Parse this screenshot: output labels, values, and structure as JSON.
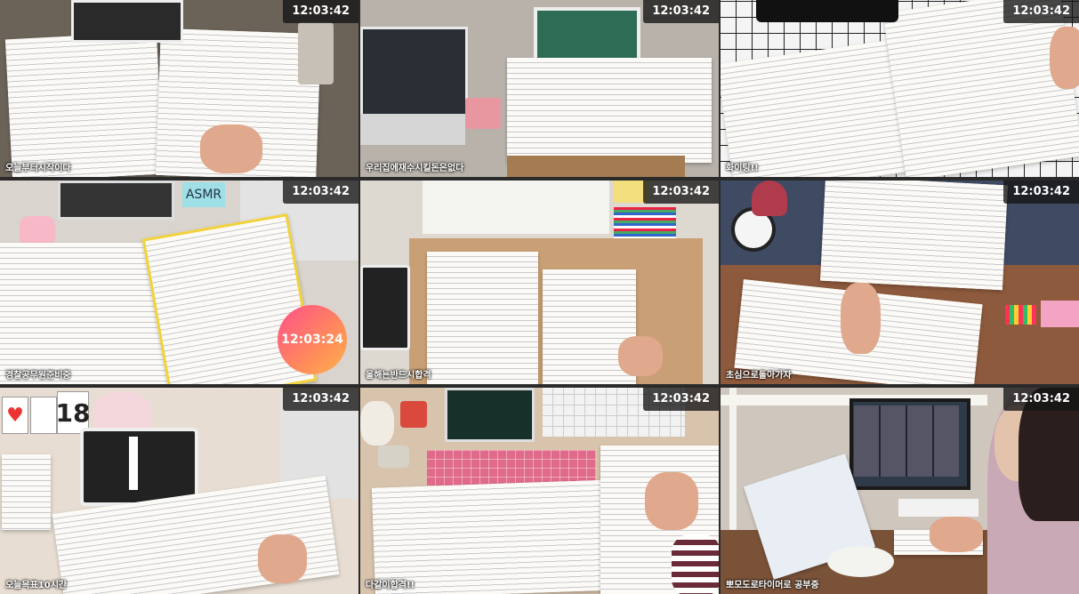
{
  "tiles": [
    {
      "timer": "12:03:42",
      "name": "오늘부터시작이다"
    },
    {
      "timer": "12:03:42",
      "name": "우리집에재수시킬돈은없다"
    },
    {
      "timer": "12:03:42",
      "name": "화이팅!!"
    },
    {
      "timer": "12:03:42",
      "name": "경찰공무원준비중",
      "badge": "12:03:24",
      "sticker": "ASMR"
    },
    {
      "timer": "12:03:42",
      "name": "올해는반드시합격"
    },
    {
      "timer": "12:03:42",
      "name": "초심으로돌아가자"
    },
    {
      "timer": "12:03:42",
      "name": "오늘목표10시간",
      "calendar": "18"
    },
    {
      "timer": "12:03:42",
      "name": "다같이합격!!"
    },
    {
      "timer": "12:03:42",
      "name": "뽀모도로타이머로 공부중"
    }
  ],
  "colors": {
    "timer_bg": "#141414",
    "badge_start": "#ff4f8a",
    "badge_end": "#ffb24a"
  }
}
